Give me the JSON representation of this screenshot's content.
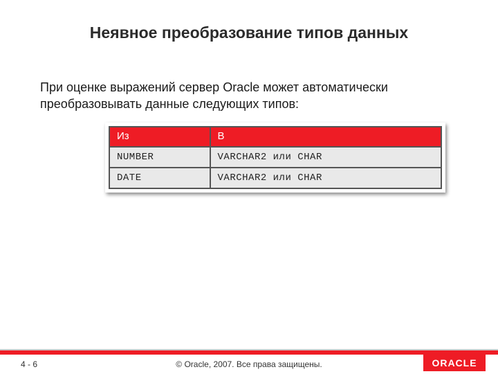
{
  "title": "Неявное преобразование типов данных",
  "body_text": "При оценке выражений сервер Oracle может автоматически преобразовывать данные следующих типов:",
  "table": {
    "headers": {
      "from": "Из",
      "to": "В"
    },
    "rows": [
      {
        "from": "NUMBER",
        "to": "VARCHAR2 или CHAR"
      },
      {
        "from": "DATE",
        "to": "VARCHAR2 или CHAR"
      }
    ]
  },
  "footer": {
    "page": "4 - 6",
    "copyright": "© Oracle, 2007. Все права защищены.",
    "logo_text": "ORACLE"
  }
}
